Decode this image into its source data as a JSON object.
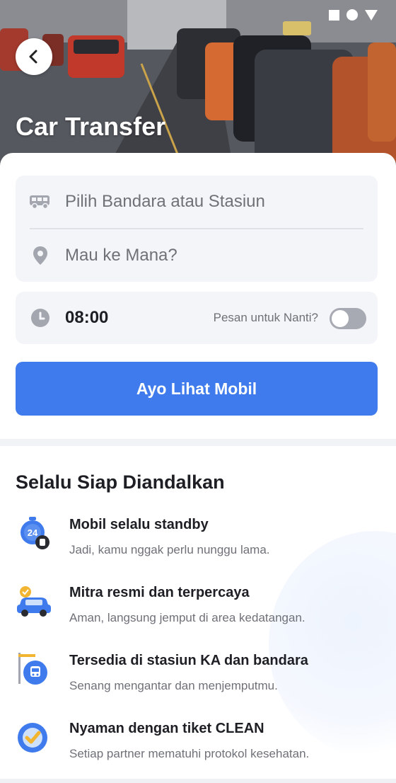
{
  "header": {
    "title": "Car Transfer"
  },
  "search": {
    "origin_placeholder": "Pilih Bandara atau Stasiun",
    "destination_placeholder": "Mau ke Mana?",
    "time_value": "08:00",
    "book_later_label": "Pesan untuk Nanti?",
    "book_later_enabled": false,
    "cta_label": "Ayo Lihat Mobil"
  },
  "benefits": {
    "title": "Selalu Siap Diandalkan",
    "items": [
      {
        "title": "Mobil selalu standby",
        "description": "Jadi, kamu nggak perlu nunggu lama.",
        "icon": "stopwatch-24-icon"
      },
      {
        "title": "Mitra resmi dan terpercaya",
        "description": "Aman, langsung jemput di area kedatangan.",
        "icon": "car-badge-icon"
      },
      {
        "title": "Tersedia di stasiun KA dan bandara",
        "description": "Senang mengantar dan menjemputmu.",
        "icon": "train-station-icon"
      },
      {
        "title": "Nyaman dengan tiket CLEAN",
        "description": "Setiap partner mematuhi protokol kesehatan.",
        "icon": "clean-check-icon"
      }
    ]
  },
  "colors": {
    "primary": "#3f7bec",
    "input_bg": "#f4f5f8",
    "text_muted": "#6f7178",
    "toggle_off": "#a7aab2"
  }
}
